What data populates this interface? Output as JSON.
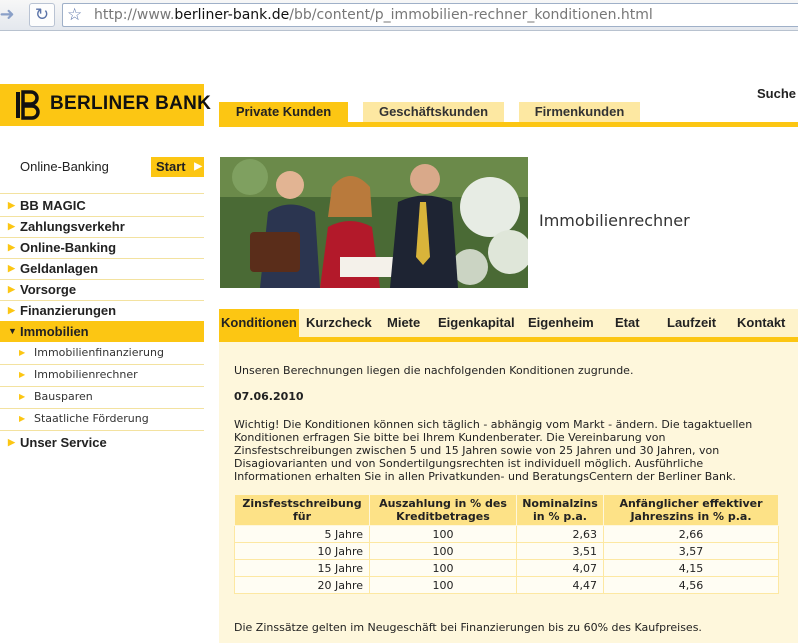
{
  "browser": {
    "url_prefix": "http://www.",
    "url_domain": "berliner-bank.de",
    "url_path": "/bb/content/p_immobilien-rechner_konditionen.html"
  },
  "brand": {
    "name": "BERLINER BANK",
    "accent": "#fcc613"
  },
  "top_tabs": [
    {
      "label": "Private Kunden"
    },
    {
      "label": "Geschäftskunden"
    },
    {
      "label": "Firmenkunden"
    }
  ],
  "search_label": "Suche",
  "sidebar": {
    "online_banking": "Online-Banking",
    "start_button": "Start",
    "items": [
      {
        "label": "BB MAGIC"
      },
      {
        "label": "Zahlungsverkehr"
      },
      {
        "label": "Online-Banking"
      },
      {
        "label": "Geldanlagen"
      },
      {
        "label": "Vorsorge"
      },
      {
        "label": "Finanzierungen"
      },
      {
        "label": "Immobilien"
      }
    ],
    "sub_items": [
      {
        "label": "Immobilienfinanzierung"
      },
      {
        "label": "Immobilienrechner"
      },
      {
        "label": "Bausparen"
      },
      {
        "label": "Staatliche Förderung"
      }
    ],
    "service": "Unser Service"
  },
  "hero": {
    "title": "Immobilienrechner"
  },
  "sub_tabs": [
    {
      "label": "Konditionen"
    },
    {
      "label": "Kurzcheck"
    },
    {
      "label": "Miete"
    },
    {
      "label": "Eigenkapital"
    },
    {
      "label": "Eigenheim"
    },
    {
      "label": "Etat"
    },
    {
      "label": "Laufzeit"
    },
    {
      "label": "Kontakt"
    }
  ],
  "content": {
    "intro": "Unseren Berechnungen liegen die nachfolgenden Konditionen zugrunde.",
    "date": "07.06.2010",
    "paragraph": "Wichtig! Die Konditionen können sich täglich - abhängig vom Markt - ändern. Die tagaktuellen Konditionen erfragen Sie bitte bei Ihrem Kundenberater. Die Vereinbarung von Zinsfestschreibungen zwischen 5 und 15 Jahren sowie von 25 Jahren und 30 Jahren, von Disagiovarianten und von Sondertilgungsrechten ist individuell möglich. Ausführliche Informationen erhalten Sie in allen Privatkunden- und BeratungsCentern der Berliner Bank.",
    "table": {
      "headers": [
        "Zinsfestschreibung für",
        "Auszahlung in % des Kreditbetrages",
        "Nominalzins in % p.a.",
        "Anfänglicher effektiver Jahreszins in % p.a."
      ],
      "rows": [
        [
          "5 Jahre",
          "100",
          "2,63",
          "2,66"
        ],
        [
          "10 Jahre",
          "100",
          "3,51",
          "3,57"
        ],
        [
          "15 Jahre",
          "100",
          "4,07",
          "4,15"
        ],
        [
          "20 Jahre",
          "100",
          "4,47",
          "4,56"
        ]
      ]
    },
    "footnote": "Die Zinssätze gelten im Neugeschäft bei Finanzierungen bis zu 60% des Kaufpreises."
  }
}
